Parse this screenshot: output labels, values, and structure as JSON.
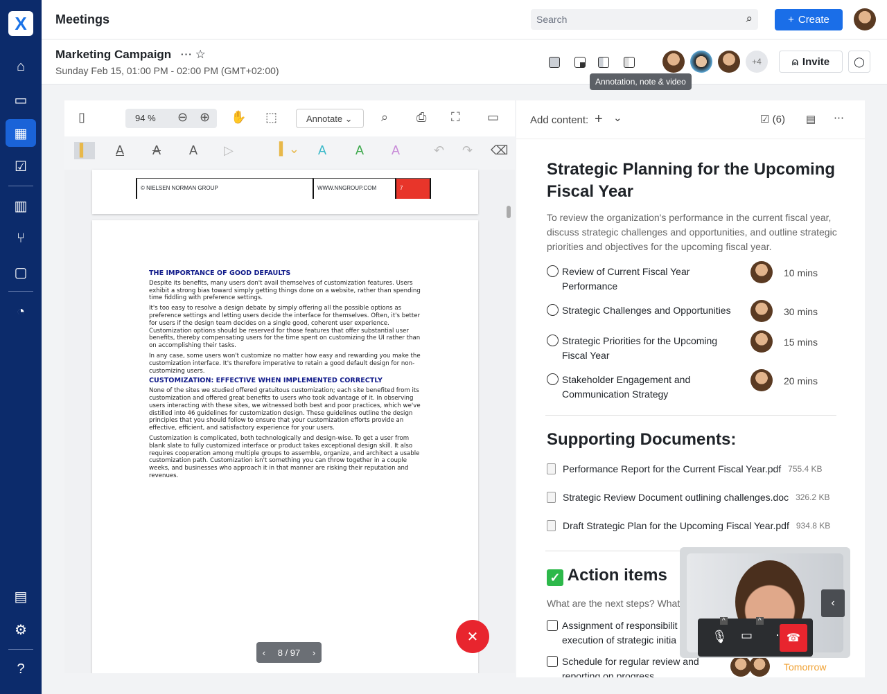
{
  "app": {
    "logo": "X",
    "title": "Meetings",
    "search_placeholder": "Search",
    "create_label": "Create"
  },
  "sidebar": {
    "items": [
      {
        "icon": "home-icon"
      },
      {
        "icon": "briefcase-icon"
      },
      {
        "icon": "calendar-icon",
        "active": true
      },
      {
        "icon": "checklist-icon"
      },
      {
        "icon": "chart-icon"
      },
      {
        "icon": "branch-icon"
      },
      {
        "icon": "folder-icon"
      },
      {
        "icon": "pie-chart-icon"
      },
      {
        "icon": "building-icon"
      },
      {
        "icon": "gear-icon"
      },
      {
        "icon": "help-icon"
      }
    ]
  },
  "meeting": {
    "title": "Marketing Campaign",
    "date": "Sunday Feb 15, 01:00 PM - 02:00 PM (GMT+02:00)",
    "more_participants": "+4",
    "invite_label": "Invite",
    "tooltip": "Annotation, note & video"
  },
  "viewer": {
    "zoom": "94 %",
    "annotate_label": "Annotate",
    "footer_left": "© NIELSEN NORMAN GROUP",
    "footer_url": "WWW.NNGROUP.COM",
    "footer_page": "7",
    "page_indicator": "8 / 97",
    "heading1": "THE IMPORTANCE OF GOOD DEFAULTS",
    "p1": "Despite its benefits, many users don't avail themselves of customization features. Users exhibit a strong bias toward simply getting things done on a website, rather than spending time fiddling with preference settings.",
    "p2": "It's too easy to resolve a design debate by simply offering all the possible options as preference settings and letting users decide the interface for themselves. Often, it's better for users if the design team decides on a single good, coherent user experience. Customization options should be reserved for those features that offer substantial user benefits, thereby compensating users for the time spent on customizing the UI rather than on accomplishing their tasks.",
    "p3": "In any case, some users won't customize no matter how easy and rewarding you make the customization interface. It's therefore imperative to retain a good default design for non-customizing users.",
    "heading2": "CUSTOMIZATION: EFFECTIVE WHEN IMPLEMENTED CORRECTLY",
    "p4": "None of the sites we studied offered gratuitous customization; each site benefited from its customization and offered great benefits to users who took advantage of it. In observing users interacting with these sites, we witnessed both best and poor practices, which we've distilled into 46 guidelines for customization design. These guidelines outline the design principles that you should follow to ensure that your customization efforts provide an effective, efficient, and satisfactory experience for your users.",
    "p5": "Customization is complicated, both technologically and design-wise. To get a user from blank slate to fully customized interface or product takes exceptional design skill. It also requires cooperation among multiple groups to assemble, organize, and architect a usable customization path. Customization isn't something you can throw together in a couple weeks, and businesses who approach it in that manner are risking their reputation and revenues."
  },
  "notes": {
    "add_content": "Add content:",
    "task_count": "(6)",
    "title": "Strategic  Planning for the Upcoming Fiscal Year",
    "description": "To review the organization's performance in the current fiscal year, discuss strategic challenges and opportunities, and outline strategic priorities and objectives for the upcoming fiscal year.",
    "agenda": [
      {
        "label": "Review of Current Fiscal Year Performance",
        "duration": "10 mins"
      },
      {
        "label": "Strategic Challenges and Opportunities",
        "duration": "30 mins"
      },
      {
        "label": "Strategic Priorities for the Upcoming Fiscal Year",
        "duration": "15 mins"
      },
      {
        "label": "Stakeholder Engagement and Communication Strategy",
        "duration": "20 mins"
      }
    ],
    "docs_title": "Supporting Documents:",
    "docs": [
      {
        "name": "Performance Report for the Current Fiscal Year.pdf",
        "size": "755.4 KB"
      },
      {
        "name": "Strategic Review Document outlining challenges.doc",
        "size": "326.2 KB"
      },
      {
        "name": "Draft Strategic Plan for the Upcoming Fiscal Year.pdf",
        "size": "934.8 KB"
      }
    ],
    "actions_title": "Action items",
    "actions_prompt": "What are the next steps? What",
    "actions": [
      {
        "label": "Assignment of responsibilit execution of strategic initia"
      },
      {
        "label": "Schedule for regular review and reporting on progress",
        "due": "Tomorrow"
      }
    ]
  },
  "colors": {
    "sidebar": "#0c2b6b",
    "primary": "#1a6ee8",
    "danger": "#e8252e",
    "due": "#f0a030"
  }
}
